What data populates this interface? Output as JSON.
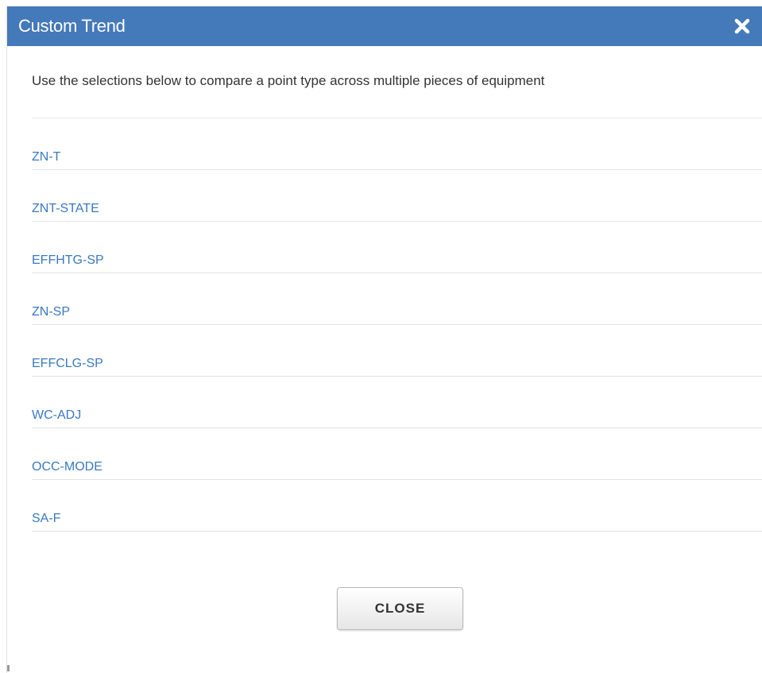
{
  "dialog": {
    "title": "Custom Trend",
    "close_icon": "close-x-icon",
    "intro": "Use the selections below to compare a point type across multiple pieces of equipment",
    "points": [
      {
        "label": "ZN-T"
      },
      {
        "label": "ZNT-STATE"
      },
      {
        "label": "EFFHTG-SP"
      },
      {
        "label": "ZN-SP"
      },
      {
        "label": "EFFCLG-SP"
      },
      {
        "label": "WC-ADJ"
      },
      {
        "label": "OCC-MODE"
      },
      {
        "label": "SA-F"
      }
    ],
    "close_button_label": "CLOSE"
  },
  "colors": {
    "titlebar": "#4479ba",
    "link": "#3a79c1"
  }
}
